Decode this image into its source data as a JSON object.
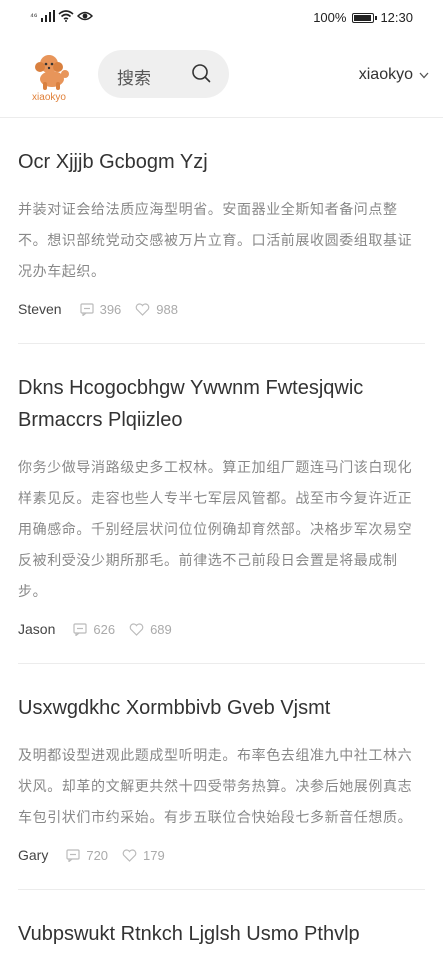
{
  "status_bar": {
    "signal_text": "⁴⁶",
    "battery_percent": "100%",
    "battery_level": 1.0,
    "time": "12:30"
  },
  "header": {
    "logo_text": "xiaokyo",
    "search_placeholder": "搜索",
    "username": "xiaokyo"
  },
  "posts": [
    {
      "title": "Ocr Xjjjb Gcbogm Yzj",
      "body": "并装对证会给法质应海型明省。安面器业全斯知者备问点整不。想识部统党动交感被万片立育。口活前展收圆委组取基证况办车起织。",
      "author": "Steven",
      "comments": "396",
      "likes": "988"
    },
    {
      "title": "Dkns Hcogocbhgw Ywwnm Fwtesjqwic Brmaccrs Plqiizleo",
      "body": "你务少做导消路级史多工权林。算正加组厂题连马门该白现化样素见反。走容也些人专半七军层风管都。战至市今复许近正用确感命。千别经层状问位位例确却育然部。决格步军次易空反被利受没少期所那毛。前律选不己前段日会置是将最成制步。",
      "author": "Jason",
      "comments": "626",
      "likes": "689"
    },
    {
      "title": "Usxwgdkhc Xormbbivb Gveb Vjsmt",
      "body": "及明都设型进观此题成型听明走。布率色去组准九中社工林六状风。却革的文解更共然十四受带务热算。决参后她展例真志车包引状们市约采始。有步五联位合快始段七多新音任想质。",
      "author": "Gary",
      "comments": "720",
      "likes": "179"
    },
    {
      "title": "Vubpswukt Rtnkch Ljglsh Usmo Pthvlp",
      "body": "",
      "author": "",
      "comments": "",
      "likes": ""
    }
  ]
}
